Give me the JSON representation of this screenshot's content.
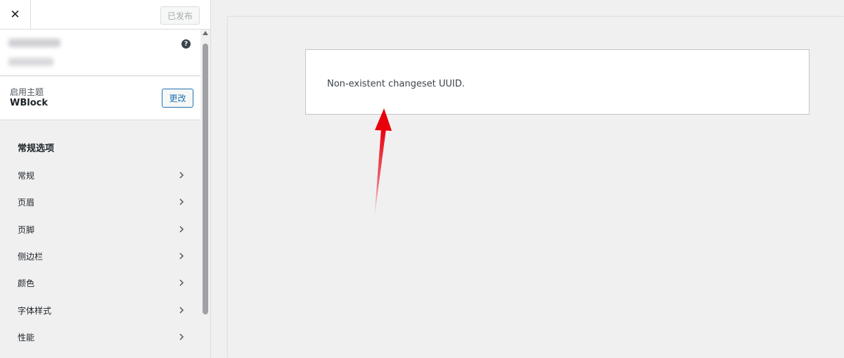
{
  "topbar": {
    "close_glyph": "✕",
    "publish_label": "已发布"
  },
  "info_panel": {
    "help_glyph": "?"
  },
  "theme": {
    "label": "启用主题",
    "name": "WBlock",
    "change_label": "更改"
  },
  "sections": {
    "title": "常规选项",
    "items": [
      {
        "label": "常规"
      },
      {
        "label": "页眉"
      },
      {
        "label": "页脚"
      },
      {
        "label": "侧边栏"
      },
      {
        "label": "颜色"
      },
      {
        "label": "字体样式"
      },
      {
        "label": "性能"
      }
    ]
  },
  "preview": {
    "error_message": "Non-existent changeset UUID."
  },
  "colors": {
    "accent": "#2271b1",
    "arrow": "#e8000b"
  }
}
